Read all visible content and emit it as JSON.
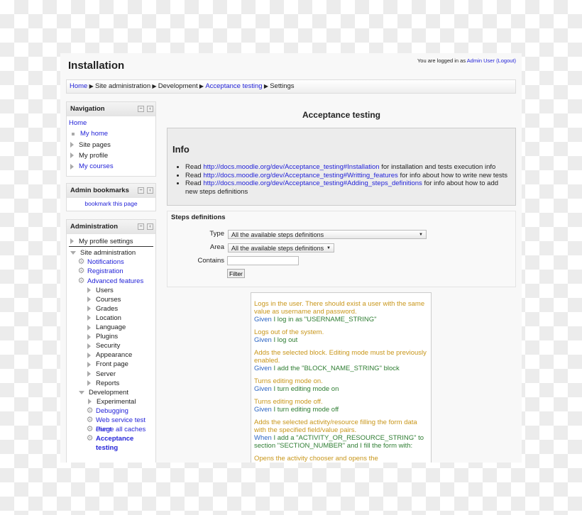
{
  "header": {
    "title": "Installation",
    "login_prefix": "You are logged in as",
    "user": "Admin User",
    "logout": "(Logout)"
  },
  "breadcrumb": [
    {
      "label": "Home",
      "link": true
    },
    {
      "label": "Site administration",
      "link": false
    },
    {
      "label": "Development",
      "link": false
    },
    {
      "label": "Acceptance testing",
      "link": true
    },
    {
      "label": "Settings",
      "link": false
    }
  ],
  "navigation": {
    "title": "Navigation",
    "home": "Home",
    "items": [
      {
        "label": "My home",
        "icon": "square",
        "link": true
      },
      {
        "label": "Site pages",
        "icon": "triangle",
        "link": false
      },
      {
        "label": "My profile",
        "icon": "triangle",
        "link": false
      },
      {
        "label": "My courses",
        "icon": "triangle",
        "link": true
      }
    ]
  },
  "bookmarks": {
    "title": "Admin bookmarks",
    "link": "bookmark this page"
  },
  "administration": {
    "title": "Administration",
    "profile": "My profile settings",
    "site": "Site administration",
    "gear_items": [
      "Notifications",
      "Registration",
      "Advanced features"
    ],
    "categories": [
      "Users",
      "Courses",
      "Grades",
      "Location",
      "Language",
      "Plugins",
      "Security",
      "Appearance",
      "Front page",
      "Server",
      "Reports"
    ],
    "development": "Development",
    "experimental": "Experimental",
    "dev_items": [
      "Debugging",
      "Web service test client",
      "Purge all caches"
    ],
    "current": "Acceptance testing"
  },
  "main": {
    "heading": "Acceptance testing",
    "info": {
      "title": "Info",
      "items": [
        {
          "pre": "Read",
          "url": "http://docs.moodle.org/dev/Acceptance_testing#Installation",
          "post": "for installation and tests execution info"
        },
        {
          "pre": "Read",
          "url": "http://docs.moodle.org/dev/Acceptance_testing#Writting_features",
          "post": "for info about how to write new tests"
        },
        {
          "pre": "Read",
          "url": "http://docs.moodle.org/dev/Acceptance_testing#Adding_steps_definitions",
          "post": "for info about how to add new steps definitions"
        }
      ]
    },
    "steps": {
      "legend": "Steps definitions",
      "type_label": "Type",
      "type_value": "All the available steps definitions",
      "area_label": "Area",
      "area_value": "All the available steps definitions",
      "contains_label": "Contains",
      "contains_value": "",
      "filter": "Filter"
    },
    "definitions": [
      {
        "desc": "Logs in the user. There should exist a user with the same value as username and password.",
        "kw": "Given",
        "step": "I log in as \"USERNAME_STRING\""
      },
      {
        "desc": "Logs out of the system.",
        "kw": "Given",
        "step": "I log out"
      },
      {
        "desc": "Adds the selected block. Editing mode must be previously enabled.",
        "kw": "Given",
        "step": "I add the \"BLOCK_NAME_STRING\" block"
      },
      {
        "desc": "Turns editing mode on.",
        "kw": "Given",
        "step": "I turn editing mode on"
      },
      {
        "desc": "Turns editing mode off.",
        "kw": "Given",
        "step": "I turn editing mode off"
      },
      {
        "desc": "Adds the selected activity/resource filling the form data with the specified field/value pairs.",
        "kw": "When",
        "step": "I add a \"ACTIVITY_OR_RESOURCE_STRING\" to section \"SECTION_NUMBER\" and I fill the form with:"
      },
      {
        "desc": "Opens the activity chooser and opens the activity/resource",
        "kw": "",
        "step": ""
      }
    ]
  },
  "colors": {
    "link": "#2323d8",
    "description": "#c8961a",
    "keyword": "#2d66c4",
    "step": "#2e7d32"
  }
}
